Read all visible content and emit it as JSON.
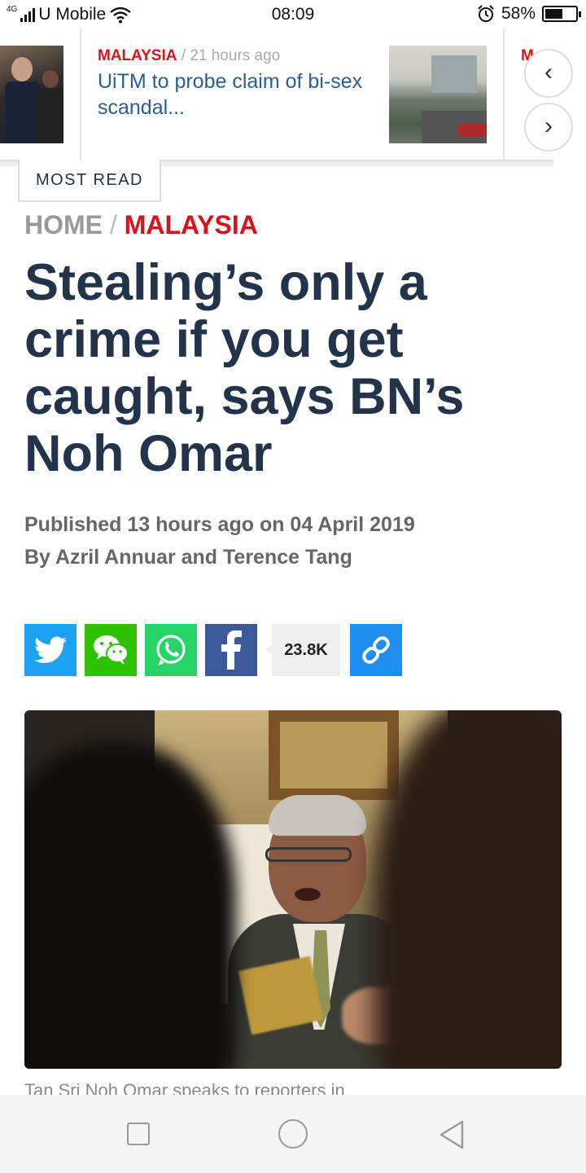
{
  "status_bar": {
    "network_type": "4G",
    "carrier": "U Mobile",
    "time": "08:09",
    "battery_percent": "58%",
    "battery_level": 0.58
  },
  "trending": {
    "items": [
      {
        "category": "MALAYSIA",
        "separator": "/",
        "time": "21 hours ago",
        "title": "UiTM to probe claim of bi-sex scandal..."
      }
    ],
    "peek_category_fragment": "M",
    "prev_label": "‹",
    "next_label": "›"
  },
  "most_read_label": "MOST READ",
  "breadcrumb": {
    "home": "HOME",
    "separator": "/",
    "category": "MALAYSIA"
  },
  "article": {
    "headline": "Stealing’s only a crime if you get caught, says BN’s Noh Omar",
    "published": "Published 13 hours ago on 04 April 2019",
    "byline": "By Azril Annuar and Terence Tang",
    "caption_fragment": "Tan Sri Noh Omar speaks to reporters in"
  },
  "share": {
    "count": "23.8K",
    "buttons": [
      "twitter-icon",
      "wechat-icon",
      "whatsapp-icon",
      "facebook-icon",
      "link-icon"
    ]
  },
  "colors": {
    "accent_red": "#d7141a",
    "headline_navy": "#22334a",
    "link_blue": "#2a5d95",
    "twitter": "#1da1f2",
    "wechat": "#2dc100",
    "whatsapp": "#25d366",
    "facebook": "#3b5998",
    "copy_link": "#1e8ff0"
  }
}
